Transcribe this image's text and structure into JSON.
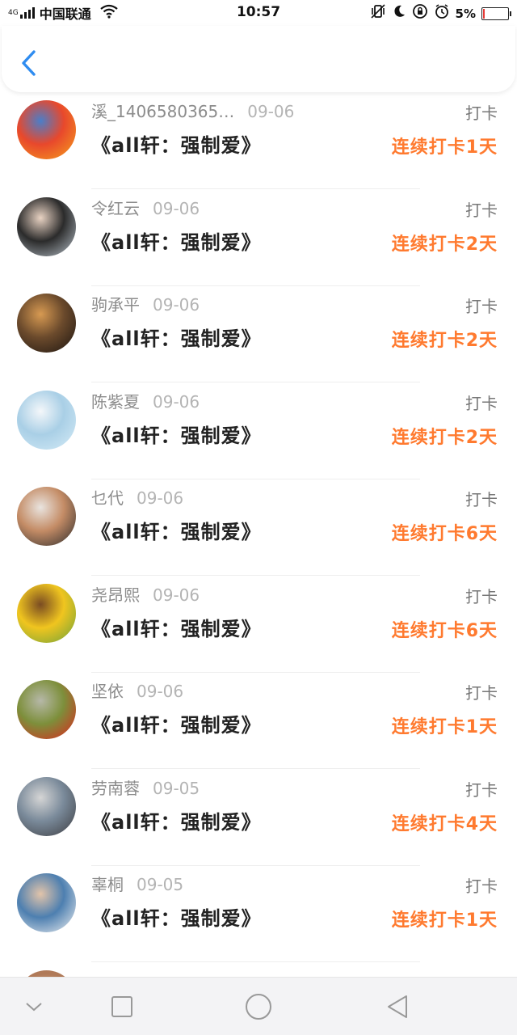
{
  "status_bar": {
    "network": "4G",
    "carrier": "中国联通",
    "time": "10:57",
    "battery_percent": "5%",
    "battery_level": 0.05,
    "battery_color": "#e53935",
    "icons": [
      "signal-icon",
      "wifi-icon",
      "vibrate-icon",
      "moon-icon",
      "rotation-lock-icon",
      "alarm-icon",
      "battery-icon"
    ]
  },
  "header": {
    "back_icon": "chevron-left-icon",
    "accent": "#2f8cf0"
  },
  "list": {
    "checkin_color": "#ff7a2f",
    "items": [
      {
        "name": "溪_1406580365…",
        "date": "09-06",
        "book": "《all轩：强制爱》",
        "checkin": "打卡",
        "streak": "连续打卡1天",
        "avatar_colors": [
          "#f6a21c",
          "#e8482c",
          "#4a7ec9"
        ]
      },
      {
        "name": "令红云",
        "date": "09-06",
        "book": "《all轩：强制爱》",
        "checkin": "打卡",
        "streak": "连续打卡2天",
        "avatar_colors": [
          "#b9c3cc",
          "#2b2b2b",
          "#e9d3c3"
        ]
      },
      {
        "name": "驹承平",
        "date": "09-06",
        "book": "《all轩：强制爱》",
        "checkin": "打卡",
        "streak": "连续打卡2天",
        "avatar_colors": [
          "#1b1410",
          "#6b4a2c",
          "#d79a52"
        ]
      },
      {
        "name": "陈紫夏",
        "date": "09-06",
        "book": "《all轩：强制爱》",
        "checkin": "打卡",
        "streak": "连续打卡2天",
        "avatar_colors": [
          "#d6ecf7",
          "#a9cfe6",
          "#f4f7fa"
        ]
      },
      {
        "name": "乜代",
        "date": "09-06",
        "book": "《all轩：强制爱》",
        "checkin": "打卡",
        "streak": "连续打卡6天",
        "avatar_colors": [
          "#2a2a2a",
          "#c48c66",
          "#e9e4df"
        ]
      },
      {
        "name": "尧昂熙",
        "date": "09-06",
        "book": "《all轩：强制爱》",
        "checkin": "打卡",
        "streak": "连续打卡6天",
        "avatar_colors": [
          "#6aa13a",
          "#f0c51f",
          "#7a4c22"
        ]
      },
      {
        "name": "坚依",
        "date": "09-06",
        "book": "《all轩：强制爱》",
        "checkin": "打卡",
        "streak": "连续打卡1天",
        "avatar_colors": [
          "#e0231c",
          "#7d8f3b",
          "#b6b8a8"
        ]
      },
      {
        "name": "劳南蓉",
        "date": "09-05",
        "book": "《all轩：强制爱》",
        "checkin": "打卡",
        "streak": "连续打卡4天",
        "avatar_colors": [
          "#3b3b3f",
          "#7a8a9a",
          "#d5d5d5"
        ]
      },
      {
        "name": "辜桐",
        "date": "09-05",
        "book": "《all轩：强制爱》",
        "checkin": "打卡",
        "streak": "连续打卡1天",
        "avatar_colors": [
          "#f2f2f2",
          "#4d7fb0",
          "#e2c4aa"
        ]
      }
    ]
  },
  "nav_bar": {
    "icons": [
      "chevron-down-icon",
      "recent-apps-icon",
      "home-icon",
      "back-triangle-icon"
    ]
  }
}
